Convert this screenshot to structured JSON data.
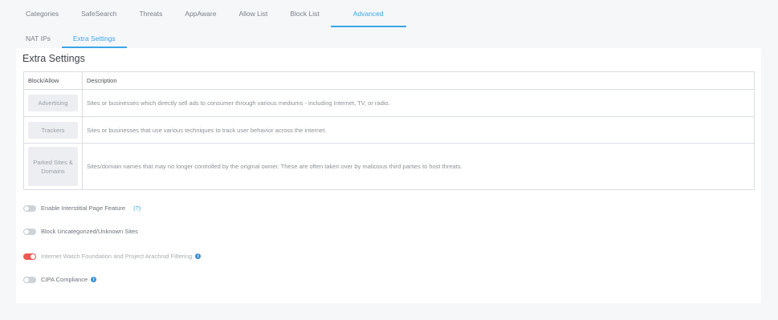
{
  "tabs": [
    {
      "label": "Categories"
    },
    {
      "label": "SafeSearch"
    },
    {
      "label": "Threats"
    },
    {
      "label": "AppAware"
    },
    {
      "label": "Allow List"
    },
    {
      "label": "Block List"
    },
    {
      "label": "Advanced"
    }
  ],
  "subtabs": [
    {
      "label": "NAT IPs"
    },
    {
      "label": "Extra Settings"
    }
  ],
  "panel": {
    "title": "Extra Settings",
    "table": {
      "headers": [
        "Block/Allow",
        "Description"
      ],
      "rows": [
        {
          "button": "Advertising",
          "description": "Sites or businesses which directly sell ads to consumer through various mediums - including Internet, TV, or radio."
        },
        {
          "button": "Trackers",
          "description": "Sites or businesses that use various techniques to track user behavior across the internet."
        },
        {
          "button": "Parked Sites & Domains",
          "description": "Sites/domain names that may no longer controlled by the original owner. These are often taken over by malicious third parties to host threats."
        }
      ]
    }
  },
  "toggles": [
    {
      "label": "Enable Interstitial Page Feature",
      "help": "(?)",
      "state": "off"
    },
    {
      "label": "Block Uncategorized/Unknown Sites",
      "state": "off"
    },
    {
      "label": "Internet Watch Foundation and Project Arachnid Filtering",
      "state": "on"
    },
    {
      "label": "CIPA Compliance",
      "state": "off"
    }
  ],
  "info_icon": "i",
  "footer": "",
  "colors": {
    "accent": "#3aa6e6",
    "toggle_on": "#ec5a53",
    "info": "#3a8fd6"
  }
}
